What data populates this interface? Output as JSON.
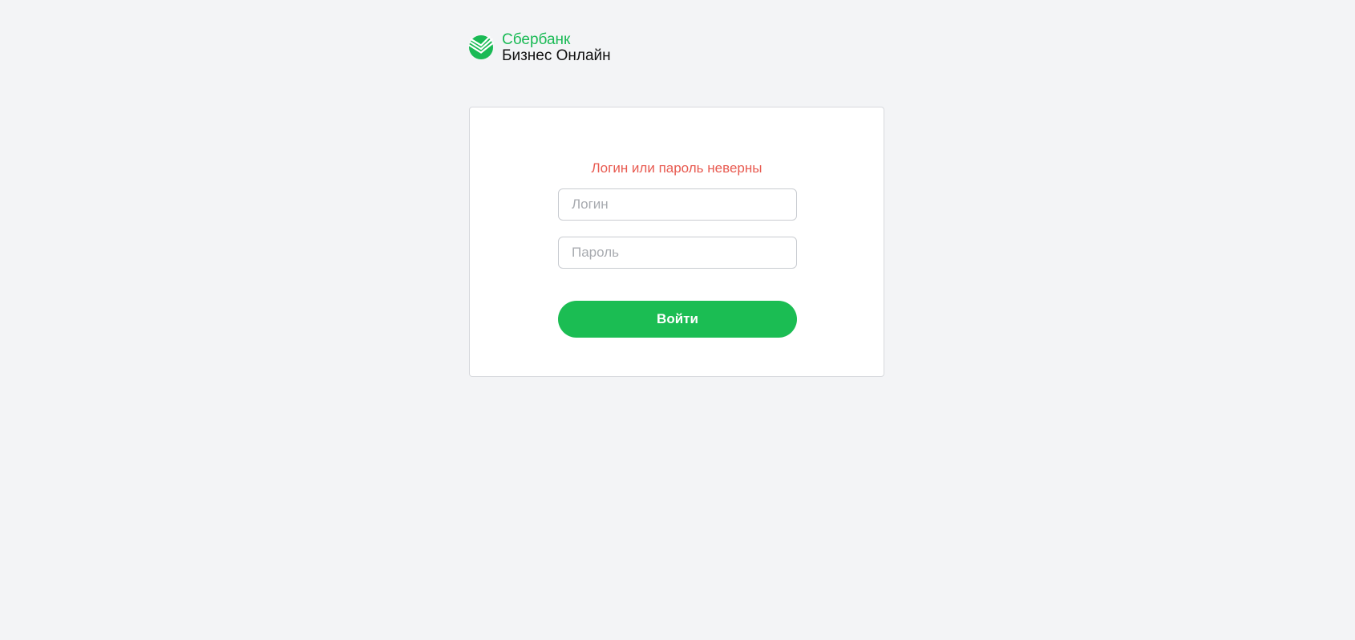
{
  "brand": {
    "name": "Сбербанк",
    "product": "Бизнес Онлайн",
    "logo_icon": "sberbank-logo-icon",
    "color": "#1aba55"
  },
  "login_form": {
    "error_message": "Логин или пароль неверны",
    "error_color": "#e85a50",
    "login_placeholder": "Логин",
    "login_value": "",
    "password_placeholder": "Пароль",
    "password_value": "",
    "submit_label": "Войти",
    "submit_color": "#1bbd53"
  }
}
